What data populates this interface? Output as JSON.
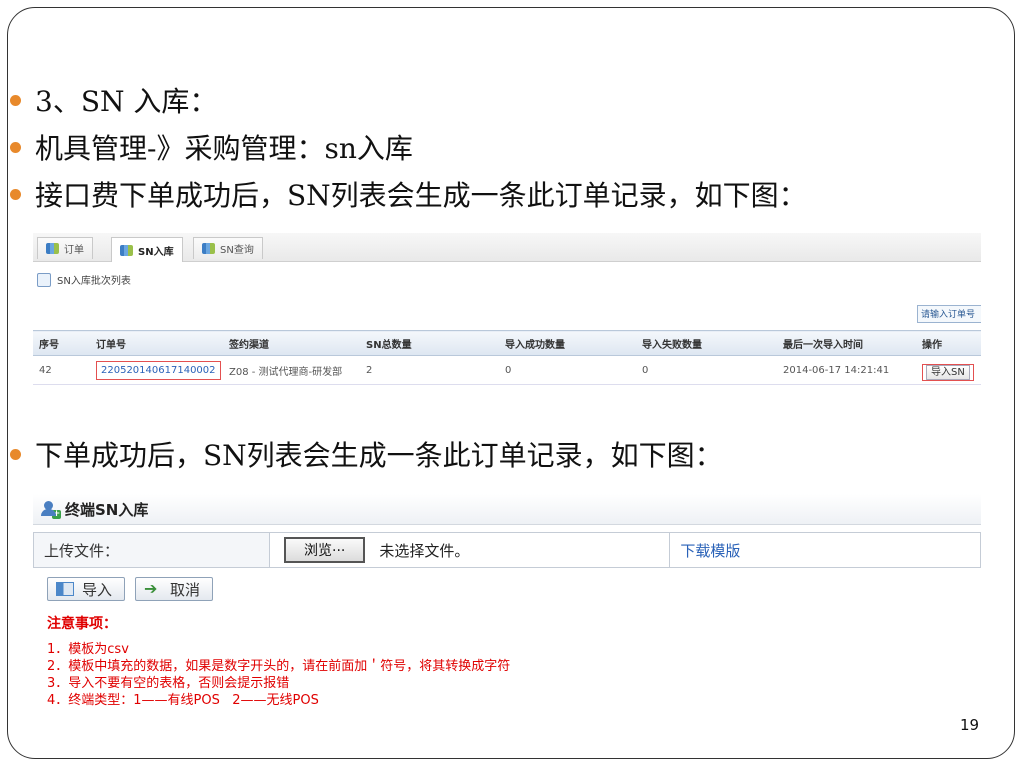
{
  "bullets": [
    "3、SN 入库：",
    "机具管理-》采购管理：sn入库",
    "接口费下单成功后，SN列表会生成一条此订单记录，如下图：",
    "下单成功后，SN列表会生成一条此订单记录，如下图："
  ],
  "shot1": {
    "tabs": [
      "订单",
      "SN入库",
      "SN查询"
    ],
    "panel_title": "SN入库批次列表",
    "search_placeholder": "请输入订单号",
    "columns": [
      "序号",
      "订单号",
      "签约渠道",
      "SN总数量",
      "导入成功数量",
      "导入失败数量",
      "最后一次导入时间",
      "操作"
    ],
    "row": [
      "42",
      "220520140617140002",
      "Z08 - 测试代理商-研发部",
      "2",
      "0",
      "0",
      "2014-06-17 14:21:41",
      "导入SN"
    ]
  },
  "shot2": {
    "title": "终端SN入库",
    "upload_label": "上传文件：",
    "browse_label": "浏览···",
    "no_file_text": "未选择文件。",
    "template_link": "下载模版",
    "import_button": "导入",
    "cancel_button": "取消",
    "notes_title": "注意事项：",
    "notes": [
      "1．模板为csv",
      "2．模板中填充的数据，如果是数字开头的，请在前面加＇符号，将其转换成字符",
      "3．导入不要有空的表格，否则会提示报错",
      "4．终端类型：1——有线POS   2——无线POS"
    ]
  },
  "page_number": "19",
  "colors": {
    "bullet": "#e8892b",
    "notes": "#e00000",
    "link": "#2a62b8"
  }
}
